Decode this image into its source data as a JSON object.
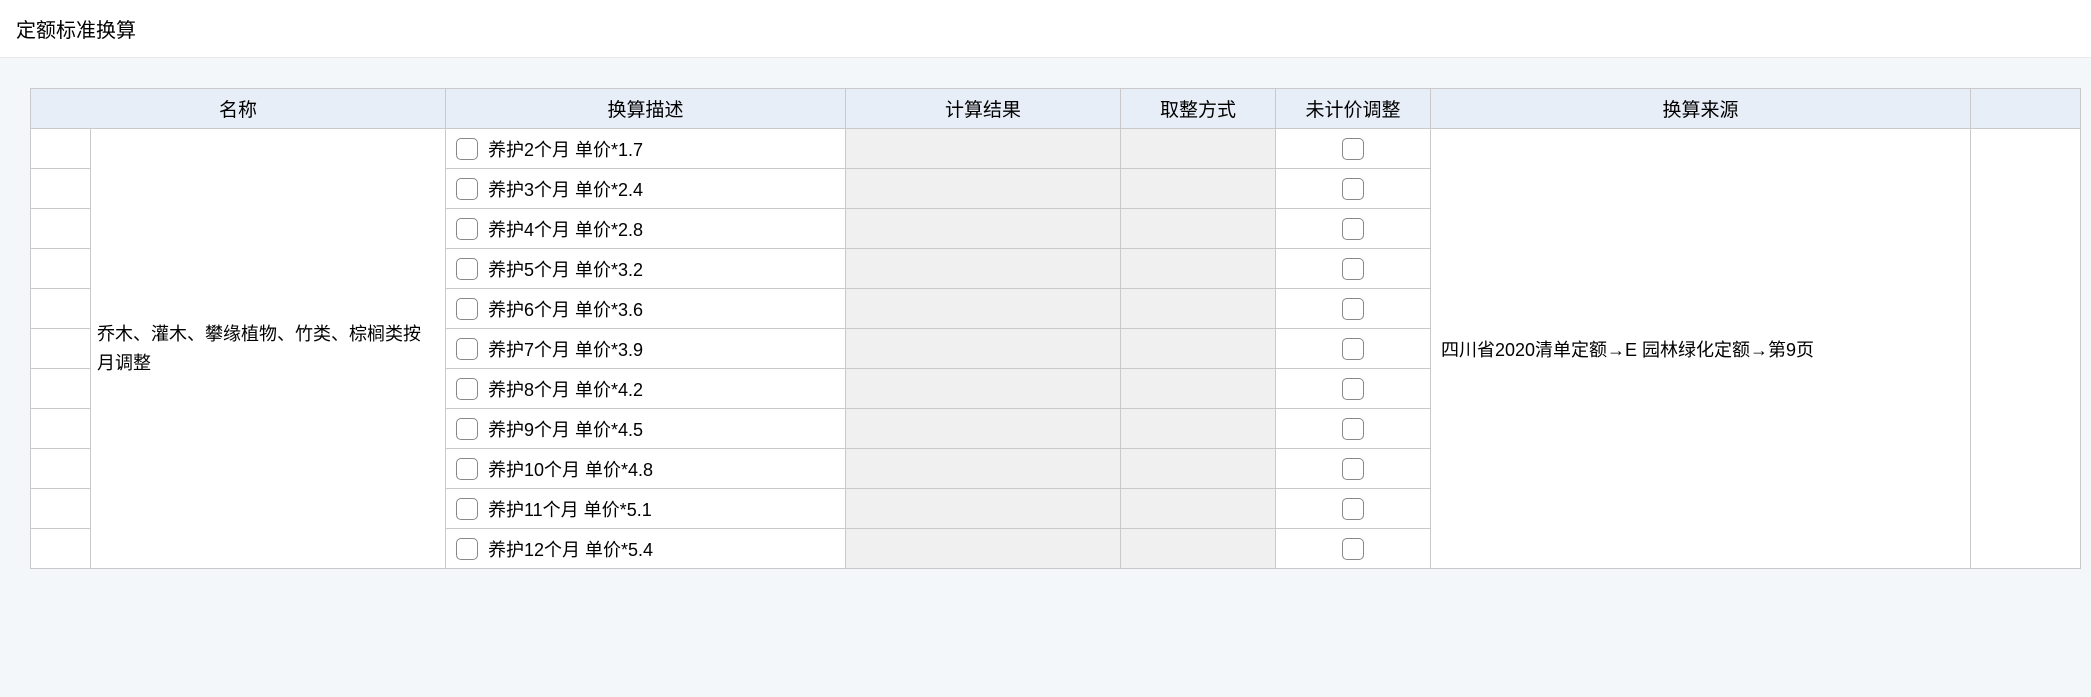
{
  "title": "定额标准换算",
  "headers": {
    "name": "名称",
    "desc": "换算描述",
    "result": "计算结果",
    "round": "取整方式",
    "adjust": "未计价调整",
    "source": "换算来源"
  },
  "group": {
    "name": "乔木、灌木、攀缘植物、竹类、棕榈类按月调整",
    "source": "四川省2020清单定额→E 园林绿化定额→第9页"
  },
  "rows": [
    {
      "desc": "养护2个月 单价*1.7"
    },
    {
      "desc": "养护3个月 单价*2.4"
    },
    {
      "desc": "养护4个月 单价*2.8"
    },
    {
      "desc": "养护5个月 单价*3.2"
    },
    {
      "desc": "养护6个月 单价*3.6"
    },
    {
      "desc": "养护7个月 单价*3.9"
    },
    {
      "desc": "养护8个月 单价*4.2"
    },
    {
      "desc": "养护9个月 单价*4.5"
    },
    {
      "desc": "养护10个月 单价*4.8"
    },
    {
      "desc": "养护11个月 单价*5.1"
    },
    {
      "desc": "养护12个月 单价*5.4"
    }
  ]
}
